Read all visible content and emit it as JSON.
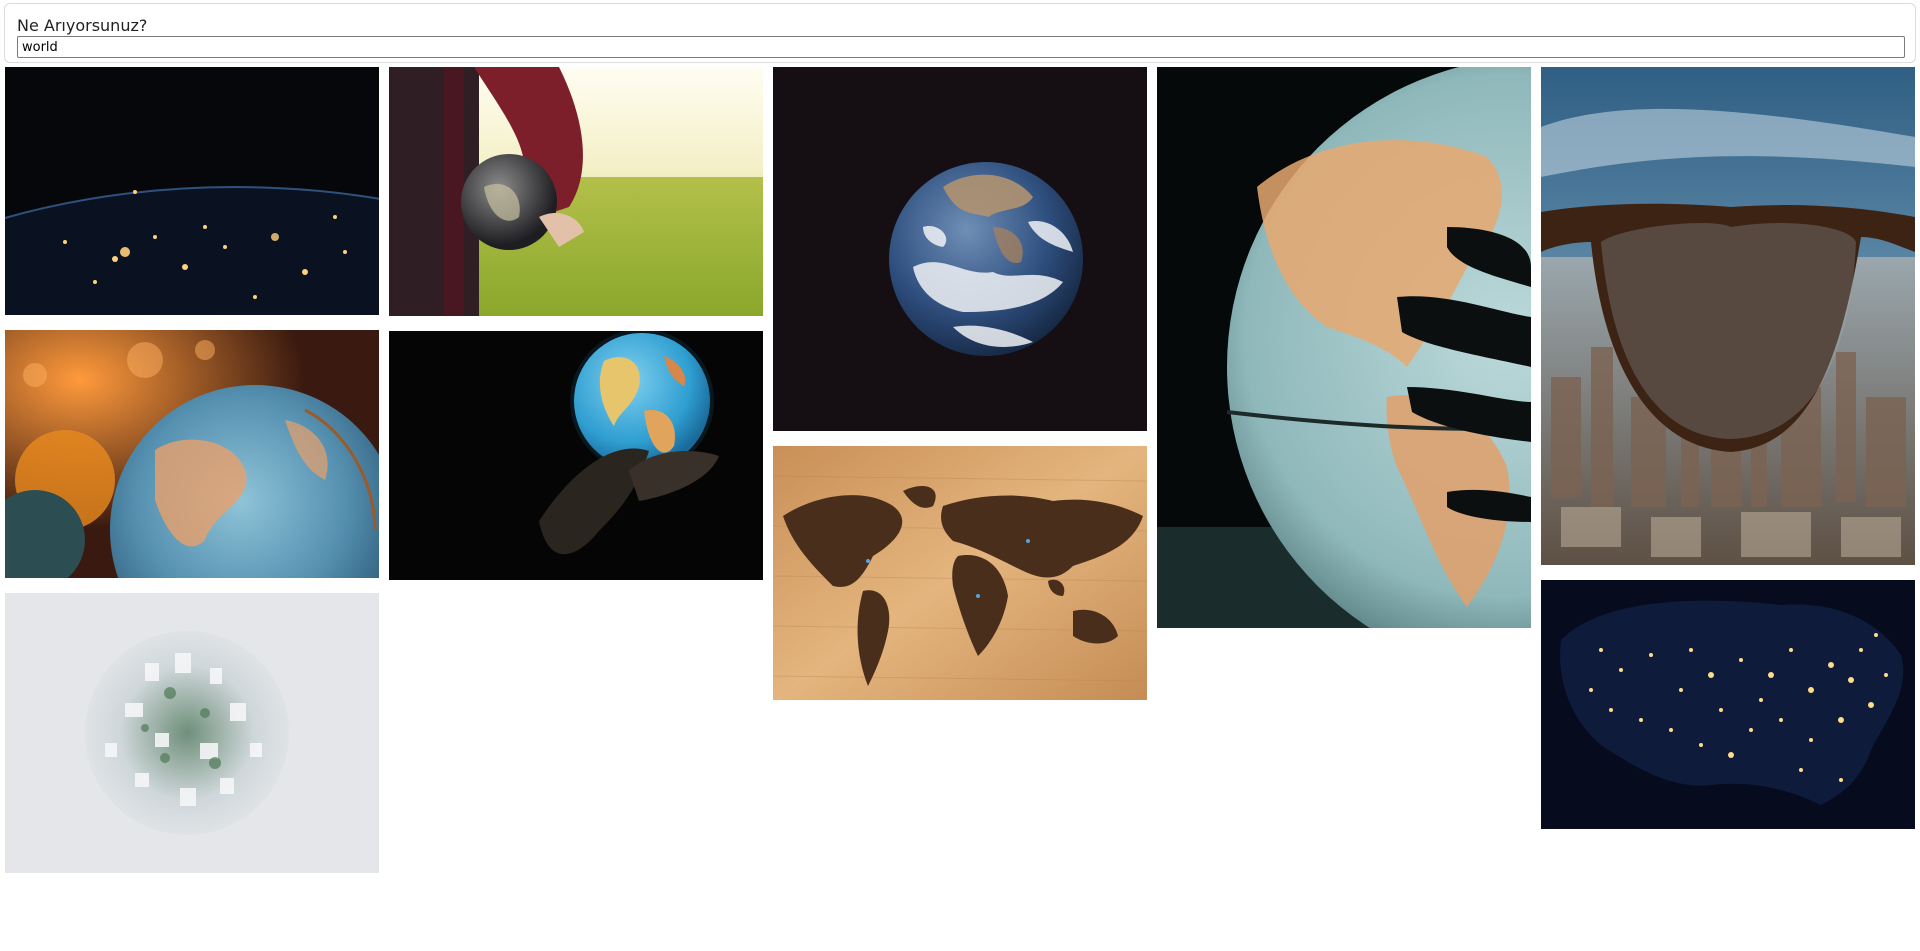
{
  "search": {
    "label": "Ne Arıyorsunuz?",
    "value": "world"
  },
  "gallery": {
    "images": [
      {
        "name": "earth-night-lights-from-space"
      },
      {
        "name": "person-holding-globe-in-field"
      },
      {
        "name": "earth-from-space-blue-marble"
      },
      {
        "name": "hand-on-illuminated-globe"
      },
      {
        "name": "city-through-eyeglasses"
      },
      {
        "name": "vintage-globes-warm-light"
      },
      {
        "name": "glowing-globe-in-hand-dark"
      },
      {
        "name": "wooden-world-map"
      },
      {
        "name": "little-planet-city"
      },
      {
        "name": "usa-night-lights-satellite"
      }
    ]
  }
}
